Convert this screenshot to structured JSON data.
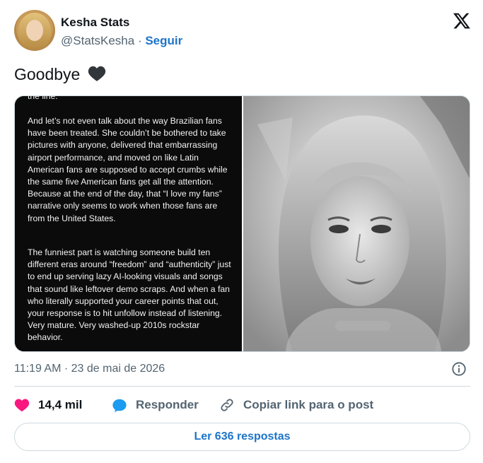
{
  "author": {
    "name": "Kesha Stats",
    "handle": "@StatsKesha",
    "separator": "·",
    "follow_label": "Seguir"
  },
  "tweet": {
    "text": "Goodbye"
  },
  "media_text": {
    "clipped_top": "the line.",
    "paragraph1": "And let’s not even talk about the way Brazilian fans have been treated. She couldn’t be bothered to take pictures with anyone, delivered that embarrassing airport performance, and moved on like Latin American fans are supposed to accept crumbs while the same five American fans get all the attention. Because at the end of the day, that “I love my fans” narrative only seems to work when those fans are from the United States.",
    "paragraph2": "The funniest part is watching someone build ten different eras around “freedom” and “authenticity” just to end up serving lazy AI-looking visuals and songs that sound like leftover demo scraps. And when a fan who literally supported your career points that out, your response is to hit unfollow instead of listening. Very mature. Very washed-up 2010s rockstar behavior."
  },
  "meta": {
    "timestamp": "11:19 AM · 23 de mai de 2026"
  },
  "actions": {
    "like_count": "14,4 mil",
    "reply_label": "Responder",
    "copy_label": "Copiar link para o post"
  },
  "footer": {
    "read_replies_label": "Ler 636 respostas"
  },
  "colors": {
    "accent": "#1d74c9",
    "like": "#f91880",
    "muted": "#536471"
  },
  "icons": [
    "x-logo-icon",
    "black-heart-icon",
    "info-icon",
    "heart-icon",
    "comment-icon",
    "link-icon"
  ]
}
